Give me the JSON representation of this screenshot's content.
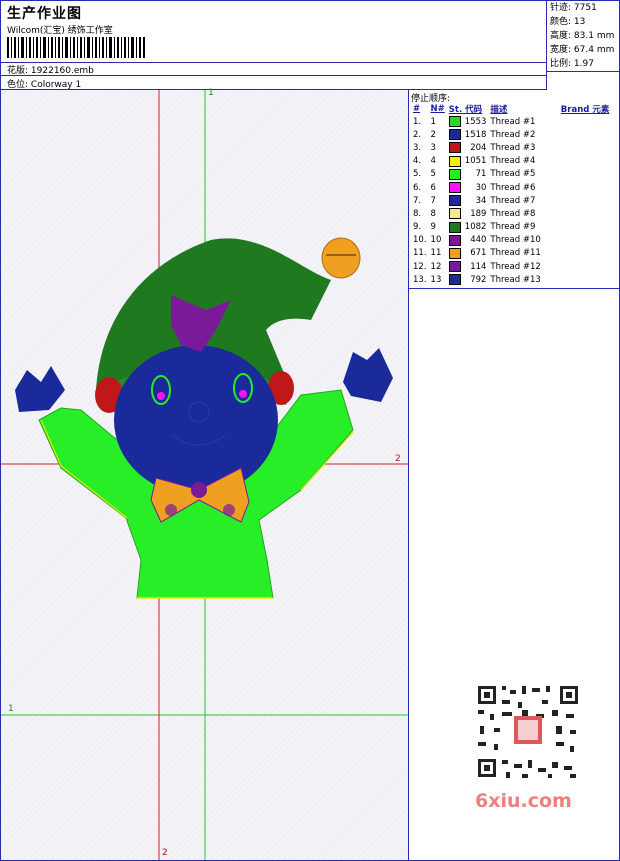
{
  "header": {
    "title": "生产作业图",
    "studio": "Wilcom(汇宝) 绣饰工作室",
    "design_label": "花版:",
    "design_value": "1922160.emb",
    "colorway_label": "色位:",
    "colorway_value": "Colorway 1"
  },
  "stats": [
    {
      "label": "针迹:",
      "value": "7751"
    },
    {
      "label": "颜色:",
      "value": "13"
    },
    {
      "label": "高度:",
      "value": "83.1 mm"
    },
    {
      "label": "宽度:",
      "value": "67.4 mm"
    },
    {
      "label": "比例:",
      "value": "1.97"
    }
  ],
  "threads_panel": {
    "title": "停止顺序:",
    "columns": [
      "#",
      "N#",
      "St.",
      "代码",
      "描述",
      "Brand",
      "元素"
    ],
    "rows": [
      {
        "n": "1.",
        "nn": "1",
        "color": "#22dd22",
        "st": "1553",
        "desc": "Thread #1"
      },
      {
        "n": "2.",
        "nn": "2",
        "color": "#1a2a9a",
        "st": "1518",
        "desc": "Thread #2"
      },
      {
        "n": "3.",
        "nn": "3",
        "color": "#c01818",
        "st": "204",
        "desc": "Thread #3"
      },
      {
        "n": "4.",
        "nn": "4",
        "color": "#f0f000",
        "st": "1051",
        "desc": "Thread #4"
      },
      {
        "n": "5.",
        "nn": "5",
        "color": "#22ee22",
        "st": "71",
        "desc": "Thread #5"
      },
      {
        "n": "6.",
        "nn": "6",
        "color": "#ff10ff",
        "st": "30",
        "desc": "Thread #6"
      },
      {
        "n": "7.",
        "nn": "7",
        "color": "#1a2a9a",
        "st": "34",
        "desc": "Thread #7"
      },
      {
        "n": "8.",
        "nn": "8",
        "color": "#f4e890",
        "st": "189",
        "desc": "Thread #8"
      },
      {
        "n": "9.",
        "nn": "9",
        "color": "#1f7a1f",
        "st": "1082",
        "desc": "Thread #9"
      },
      {
        "n": "10.",
        "nn": "10",
        "color": "#7a1a9a",
        "st": "440",
        "desc": "Thread #10"
      },
      {
        "n": "11.",
        "nn": "11",
        "color": "#f0a020",
        "st": "671",
        "desc": "Thread #11"
      },
      {
        "n": "12.",
        "nn": "12",
        "color": "#7a1a9a",
        "st": "114",
        "desc": "Thread #12"
      },
      {
        "n": "13.",
        "nn": "13",
        "color": "#1a2a9a",
        "st": "792",
        "desc": "Thread #13"
      }
    ]
  },
  "canvas": {
    "guide_label_1": "1",
    "guide_label_2": "2"
  },
  "watermark": {
    "site": "6xiu.com"
  }
}
